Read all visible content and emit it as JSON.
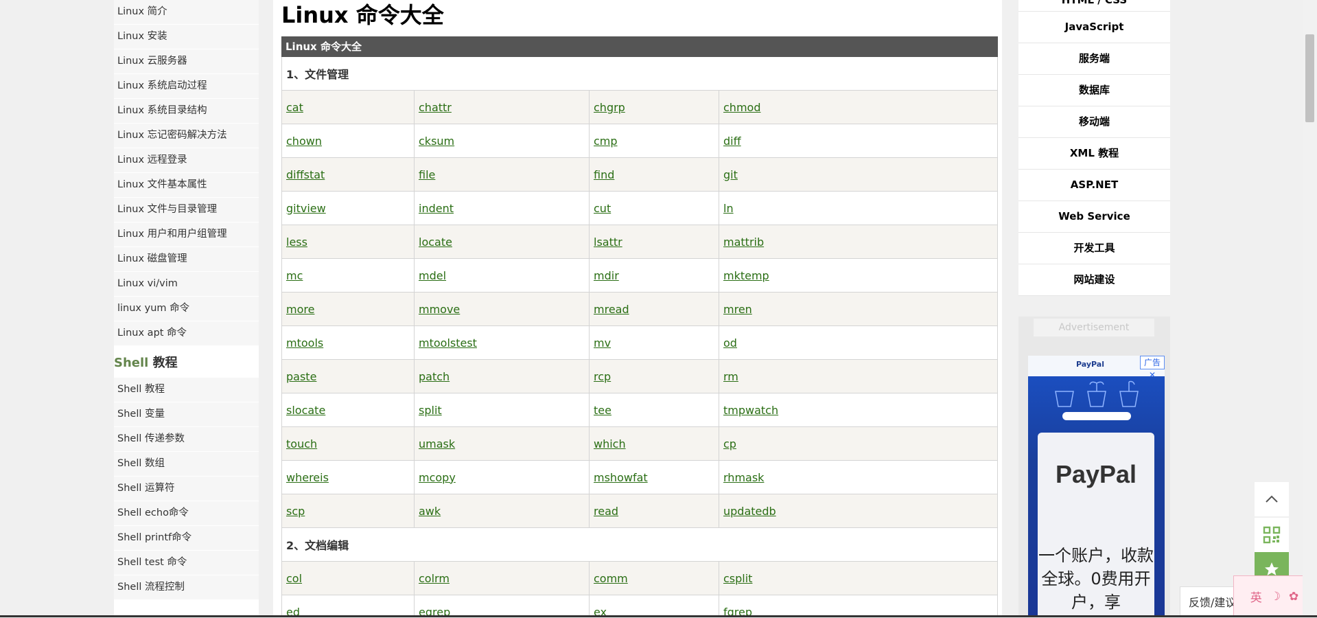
{
  "left_sidebar": {
    "linux_items": [
      "Linux 简介",
      "Linux 安装",
      "Linux 云服务器",
      "Linux 系统启动过程",
      "Linux 系统目录结构",
      "Linux 忘记密码解决方法",
      "Linux 远程登录",
      "Linux 文件基本属性",
      "Linux 文件与目录管理",
      "Linux 用户和用户组管理",
      "Linux 磁盘管理",
      "Linux vi/vim",
      "linux yum 命令",
      "Linux apt 命令"
    ],
    "shell_heading_accent": "Shell",
    "shell_heading_rest": " 教程",
    "shell_items": [
      "Shell 教程",
      "Shell 变量",
      "Shell 传递参数",
      "Shell 数组",
      "Shell 运算符",
      "Shell echo命令",
      "Shell printf命令",
      "Shell test 命令",
      "Shell 流程控制"
    ]
  },
  "main": {
    "title": "Linux 命令大全",
    "table_header": "Linux 命令大全",
    "section1": "1、文件管理",
    "section1_rows": [
      [
        "cat",
        "chattr",
        "chgrp",
        "chmod"
      ],
      [
        "chown",
        "cksum",
        "cmp",
        "diff"
      ],
      [
        "diffstat",
        "file",
        "find",
        "git"
      ],
      [
        "gitview",
        "indent",
        "cut",
        "ln"
      ],
      [
        "less",
        "locate",
        "lsattr",
        "mattrib"
      ],
      [
        "mc",
        "mdel",
        "mdir",
        "mktemp"
      ],
      [
        "more",
        "mmove",
        "mread",
        "mren"
      ],
      [
        "mtools",
        "mtoolstest",
        "mv",
        "od"
      ],
      [
        "paste",
        "patch",
        "rcp",
        "rm"
      ],
      [
        "slocate",
        "split",
        "tee",
        "tmpwatch"
      ],
      [
        "touch",
        "umask",
        "which",
        "cp"
      ],
      [
        "whereis",
        "mcopy",
        "mshowfat",
        "rhmask"
      ],
      [
        "scp",
        "awk",
        "read",
        "updatedb"
      ]
    ],
    "section2": "2、文档编辑",
    "section2_rows": [
      [
        "col",
        "colrm",
        "comm",
        "csplit"
      ],
      [
        "ed",
        "egrep",
        "ex",
        "fgrep"
      ]
    ]
  },
  "right_sidebar": {
    "partial_item": "HTML / CSS",
    "items": [
      "JavaScript",
      "服务端",
      "数据库",
      "移动端",
      "XML 教程",
      "ASP.NET",
      "Web Service",
      "开发工具",
      "网站建设"
    ],
    "ad_label": "Advertisement",
    "ad": {
      "brand": "PayPal",
      "close": "广告",
      "logo": "PayPal",
      "text": "一个账户，收款全球。0费用开户，享"
    }
  },
  "floating": {
    "feedback": "反馈/建议",
    "ime_char": "英"
  },
  "colors": {
    "link": "#2a6e14",
    "table_header_bg": "#555555",
    "accent_green": "#64854c",
    "tool_green": "#7ab55c"
  }
}
